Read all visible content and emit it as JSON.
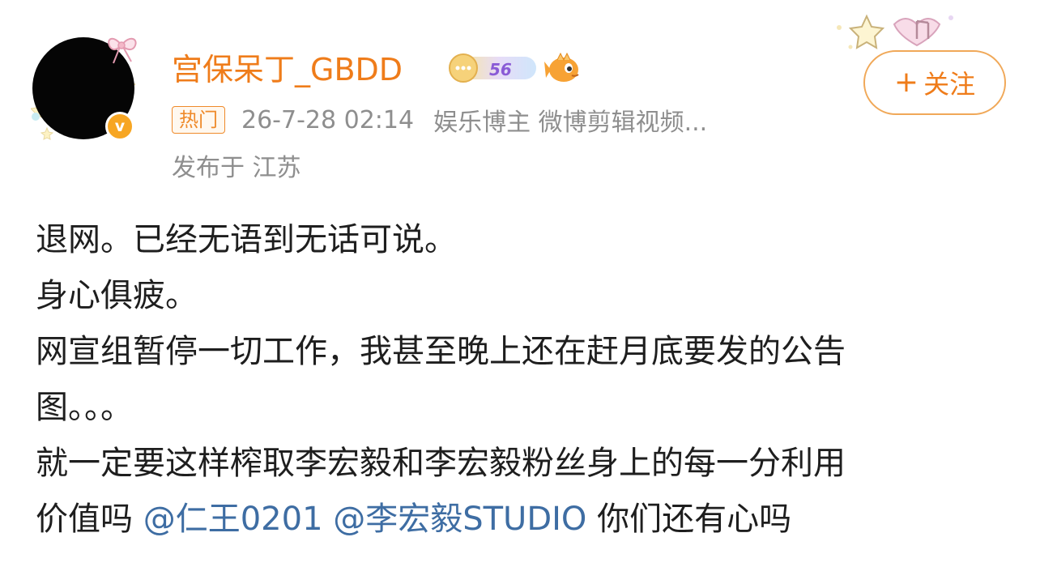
{
  "user": {
    "name": "宫保呆丁_GBDD",
    "vip_level": "56",
    "avatar_icon": "avatar-image",
    "verified_icon": "verified-v-icon",
    "verified_glyph": "v"
  },
  "meta": {
    "hot_tag": "热门",
    "timestamp": "26-7-28 02:14",
    "category": "娱乐博主 微博剪辑视频...",
    "location": "发布于 江苏"
  },
  "follow": {
    "plus": "+",
    "label": "关注"
  },
  "post": {
    "line1": "退网。已经无语到无话可说。",
    "line2": "身心俱疲。",
    "line3": "网宣组暂停一切工作，我甚至晚上还在赶月底要发的公告",
    "line4": "图。。。",
    "line5": "就一定要这样榨取李宏毅和李宏毅粉丝身上的每一分利用",
    "line6_prefix": "价值吗 ",
    "mention1": "@仁王0201",
    "mention2": "@李宏毅STUDIO",
    "line6_suffix": " 你们还有心吗"
  },
  "colors": {
    "accent": "#ef7c1a",
    "mention": "#3e6da3",
    "meta": "#8e8e8e"
  }
}
